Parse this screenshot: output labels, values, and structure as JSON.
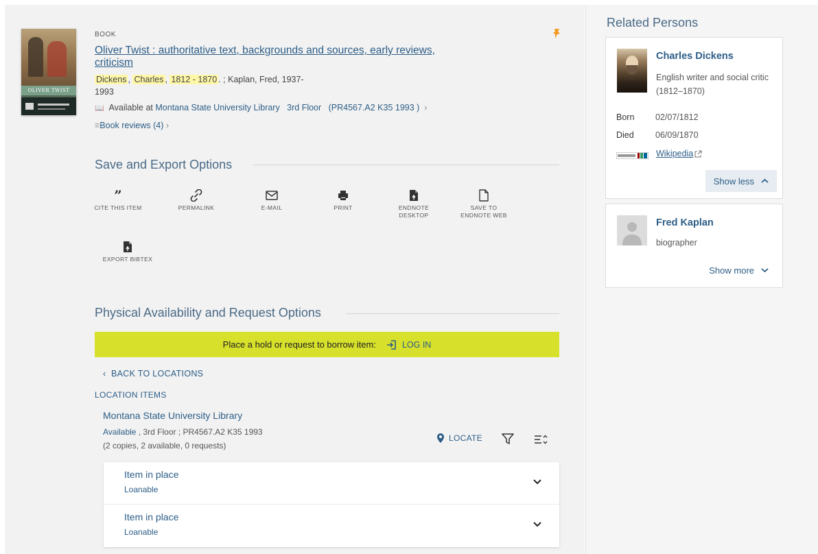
{
  "record": {
    "type": "BOOK",
    "title": "Oliver Twist : authoritative text, backgrounds and sources, early reviews, criticism",
    "author_last": "Dickens",
    "author_first": "Charles",
    "author_dates": "1812 - 1870",
    "author_sep1": ",",
    "author_sep2": ",",
    "author_sep3": ". ;",
    "coauthor": "Kaplan, Fred, 1937-",
    "coauthor_year": "1993",
    "availability_prefix": "Available at",
    "library": "Montana State University Library",
    "location": "3rd Floor",
    "callnumber": "(PR4567.A2 K35 1993 )",
    "reviews": "Book reviews (4)",
    "cover_title": "OLIVER TWIST"
  },
  "save_export": {
    "heading": "Save and Export Options",
    "actions": [
      {
        "label": "CITE THIS ITEM",
        "icon": "quote-icon"
      },
      {
        "label": "PERMALINK",
        "icon": "link-icon"
      },
      {
        "label": "E-MAIL",
        "icon": "email-icon"
      },
      {
        "label": "PRINT",
        "icon": "print-icon"
      },
      {
        "label": "ENDNOTE DESKTOP",
        "icon": "endnote-icon"
      },
      {
        "label": "SAVE TO ENDNOTE WEB",
        "icon": "file-icon"
      },
      {
        "label": "EXPORT BIBTEX",
        "icon": "bibtex-icon"
      }
    ]
  },
  "physical": {
    "heading": "Physical Availability and Request Options",
    "hold_text": "Place a hold or request to borrow item:",
    "login_label": "LOG IN",
    "back_label": "BACK TO LOCATIONS",
    "location_items_label": "LOCATION ITEMS",
    "library_name": "Montana State University Library",
    "status": "Available",
    "status_rest": ", 3rd Floor ; PR4567.A2 K35 1993",
    "copies": "(2 copies, 2 available, 0 requests)",
    "locate_label": "LOCATE",
    "items": [
      {
        "title": "Item in place",
        "policy": "Loanable"
      },
      {
        "title": "Item in place",
        "policy": "Loanable"
      }
    ]
  },
  "related": {
    "heading": "Related Persons",
    "persons": [
      {
        "name": "Charles Dickens",
        "description": "English writer and social critic (1812–1870)",
        "born_label": "Born",
        "born": "02/07/1812",
        "died_label": "Died",
        "died": "06/09/1870",
        "wikipedia": "Wikipedia",
        "toggle": "Show less"
      },
      {
        "name": "Fred Kaplan",
        "description": "biographer",
        "toggle": "Show more"
      }
    ]
  },
  "colors": {
    "accent": "#2c5d87",
    "hold_bar": "#d7e02a",
    "pin": "#f29a1f"
  }
}
